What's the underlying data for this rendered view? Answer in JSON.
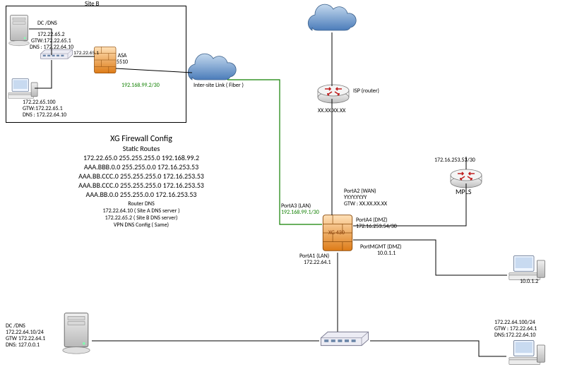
{
  "siteB": {
    "title": "Site B",
    "dc": {
      "label": "DC /DNS",
      "ip": "172.22.65.2",
      "gtw": "GTW:172.22.65.1",
      "dns": "DNS : 172.22.64.10"
    },
    "pc": {
      "ip": "172.22.65.100",
      "gtw": "GTW:172.22.65.1",
      "dns": "DNS : 172.22.64.10"
    },
    "switch_ip": "172.22.65.1",
    "asa": {
      "line1": "ASA",
      "line2": "5510"
    },
    "asa_wan": "192.168.99.2/30"
  },
  "intersite": "Inter-site Link ( Fiber )",
  "isp": {
    "label": "ISP  (router)",
    "ip": "XX.XX.XX.XX"
  },
  "xg": {
    "label": "XG 430",
    "portA2": {
      "name": "PortA2 (WAN)",
      "ip": "YY.YY.YY.YY",
      "gtw": "GTW : XX.XX.XX.XX"
    },
    "portA3": {
      "name": "PortA3 (LAN)",
      "ip": "192.168.99.1/30"
    },
    "portA4": {
      "name": "PortA4 (DMZ)",
      "ip": "172.16.253.54/30"
    },
    "portA1": {
      "name": "PortA1 (LAN)",
      "ip": "172.22.64.1"
    },
    "portMgmt": {
      "name": "PortMGMT (DMZ)",
      "ip": "10.0.1.1"
    }
  },
  "mpls": {
    "label": "MPLS",
    "ip": "172.16.253.53/30"
  },
  "mgmtpc": {
    "ip": "10.0.1.2"
  },
  "siteA_dc": {
    "label": "DC /DNS",
    "ip": "172.22.64.10/24",
    "gtw": "GTW 172.22.64.1",
    "dns": "DNS: 127.0.0.1"
  },
  "siteA_pc": {
    "ip": "172.22.64.100/24",
    "gtw": "GTW : 172.22.64.1",
    "dns": "DNS:172.22.64.10"
  },
  "config": {
    "title": "XG Firewall Config",
    "subtitle1": "Static Routes",
    "routes": [
      "172.22.65.0   255.255.255.0    192.168.99.2",
      "AAA.BBB.0.0 255.255.0.0   172.16.253.53",
      "AAA.BB.CCC.0 255.255.255.0 172.16.253.53",
      "AAA.BB.CCC.0 255.255.255.0 172.16.253.53",
      "AAA.BB.0.0 255.255.0.0   172.16.253.53"
    ],
    "subtitle2": "Router DNS",
    "dns1": "172.22.64.10 ( Site A DNS server )",
    "dns2": "172.22.65.2 ( Site B DNS server)",
    "vpn": "VPN DNS Config ( Same)"
  }
}
